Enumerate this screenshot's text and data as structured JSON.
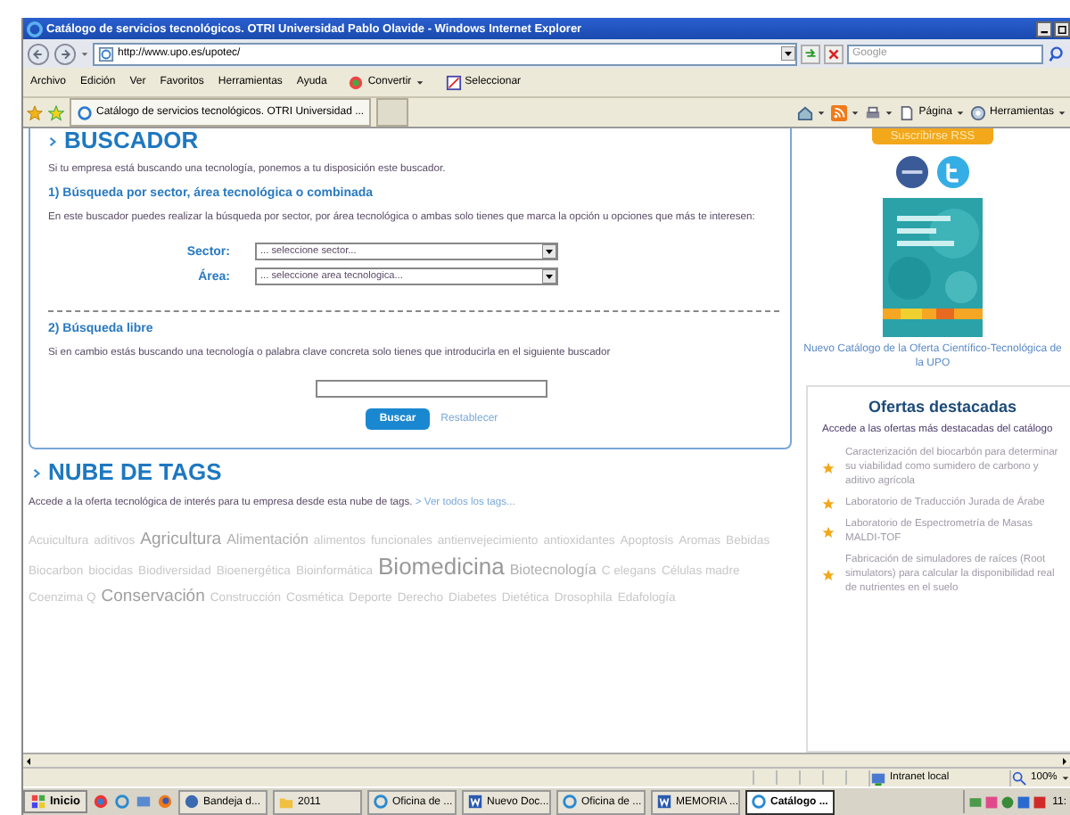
{
  "window": {
    "title": "Catálogo de servicios tecnológicos. OTRI Universidad Pablo Olavide - Windows Internet Explorer"
  },
  "address_bar": {
    "value": "http://www.upo.es/upotec/"
  },
  "search": {
    "placeholder": "Google"
  },
  "menu": [
    "Archivo",
    "Edición",
    "Ver",
    "Favoritos",
    "Herramientas",
    "Ayuda"
  ],
  "toolbar_buttons": [
    {
      "label": "Convertir",
      "kind": "convert"
    },
    {
      "label": "Seleccionar",
      "kind": "select"
    }
  ],
  "tabs": [
    {
      "label": "Catálogo de servicios tecnológicos. OTRI Universidad ...",
      "selected": true
    }
  ],
  "command_bar": [
    {
      "kind": "home"
    },
    {
      "kind": "feed"
    },
    {
      "kind": "print"
    },
    {
      "label": "Página",
      "kind": "page"
    },
    {
      "label": "Herramientas",
      "kind": "tools"
    }
  ],
  "buscador": {
    "title": "BUSCADOR",
    "intro": "Si tu empresa está buscando una tecnología, ponemos a tu disposición este buscador.",
    "section1": {
      "title": "1) Búsqueda por sector, área tecnológica o combinada",
      "text": "En este buscador puedes realizar la búsqueda por sector, por área tecnológica o ambas solo tienes que marca la opción u opciones que más te interesen:",
      "fields": [
        {
          "label": "Sector:",
          "value": "... seleccione sector..."
        },
        {
          "label": "Área:",
          "value": "... seleccione area tecnologica..."
        }
      ]
    },
    "section2": {
      "title": "2) Búsqueda libre",
      "text": "Si en cambio estás buscando una tecnología o palabra clave concreta solo tienes que introducirla en el siguiente buscador"
    },
    "search_button": "Buscar",
    "reset_link": "Restablecer"
  },
  "tags": {
    "title": "NUBE DE TAGS",
    "intro": "Accede a la oferta tecnológica de interés para tu empresa desde esta nube de tags.",
    "link": "> Ver todos los tags...",
    "items": [
      {
        "text": "Acuicultura",
        "kind": "small"
      },
      {
        "text": "aditivos",
        "kind": "small"
      },
      {
        "text": "Agricultura",
        "kind": "medium"
      },
      {
        "text": "Alimentación",
        "kind": "normal"
      },
      {
        "text": "alimentos",
        "kind": "small"
      },
      {
        "text": "funcionales",
        "kind": "small"
      },
      {
        "text": "antienvejecimiento",
        "kind": "small"
      },
      {
        "text": "antioxidantes",
        "kind": "small"
      },
      {
        "text": "Apoptosis",
        "kind": "small"
      },
      {
        "text": "Aromas",
        "kind": "small"
      },
      {
        "text": "Bebidas",
        "kind": "small"
      },
      {
        "text": "Biocarbon",
        "kind": "small"
      },
      {
        "text": "biocidas",
        "kind": "small"
      },
      {
        "text": "Biodiversidad",
        "kind": "small"
      },
      {
        "text": "Bioenergética",
        "kind": "small"
      },
      {
        "text": "Bioinformática",
        "kind": "small"
      },
      {
        "text": "Biomedicina",
        "kind": "large"
      },
      {
        "text": "Biotecnología",
        "kind": "normal"
      },
      {
        "text": "C elegans",
        "kind": "small"
      },
      {
        "text": "Células madre",
        "kind": "small"
      },
      {
        "text": "Coenzima Q",
        "kind": "small"
      },
      {
        "text": "Conservación",
        "kind": "medium"
      },
      {
        "text": "Construcción",
        "kind": "small"
      },
      {
        "text": "Cosmética",
        "kind": "small"
      },
      {
        "text": "Deporte",
        "kind": "small"
      },
      {
        "text": "Derecho",
        "kind": "small"
      },
      {
        "text": "Diabetes",
        "kind": "small"
      },
      {
        "text": "Dietética",
        "kind": "small"
      },
      {
        "text": "Drosophila",
        "kind": "small"
      },
      {
        "text": "Edafología",
        "kind": "small"
      }
    ]
  },
  "sidebar": {
    "rss_button": "Suscribirse RSS",
    "catalog_link": "Nuevo Catálogo de la Oferta Científico-Tecnológica de la UPO",
    "featured": {
      "title": "Ofertas destacadas",
      "intro": "Accede a las ofertas más destacadas del catálogo",
      "items": [
        "Caracterización del biocarbón para determinar su viabilidad como sumidero de carbono y aditivo agrícola",
        "Laboratorio de Traducción Jurada de Árabe",
        "Laboratorio de Espectrometría de Masas MALDI-TOF",
        "Fabricación de simuladores de raíces (Root simulators) para calcular la disponibilidad real de nutrientes en el suelo"
      ]
    }
  },
  "status_bar": {
    "zone": "Intranet local",
    "zoom": "100%"
  },
  "taskbar": {
    "start": "Inicio",
    "items": [
      {
        "label": "Bandeja d...",
        "kind": "mail",
        "selected": false
      },
      {
        "label": "2011",
        "kind": "folder",
        "selected": false
      },
      {
        "label": "Oficina de ...",
        "kind": "ie",
        "selected": false
      },
      {
        "label": "Nuevo Doc...",
        "kind": "word",
        "selected": false
      },
      {
        "label": "Oficina de ...",
        "kind": "ie",
        "selected": false
      },
      {
        "label": "MEMORIA ...",
        "kind": "word",
        "selected": false
      },
      {
        "label": "Catálogo ...",
        "kind": "ie",
        "selected": true
      }
    ],
    "clock": "11:"
  }
}
